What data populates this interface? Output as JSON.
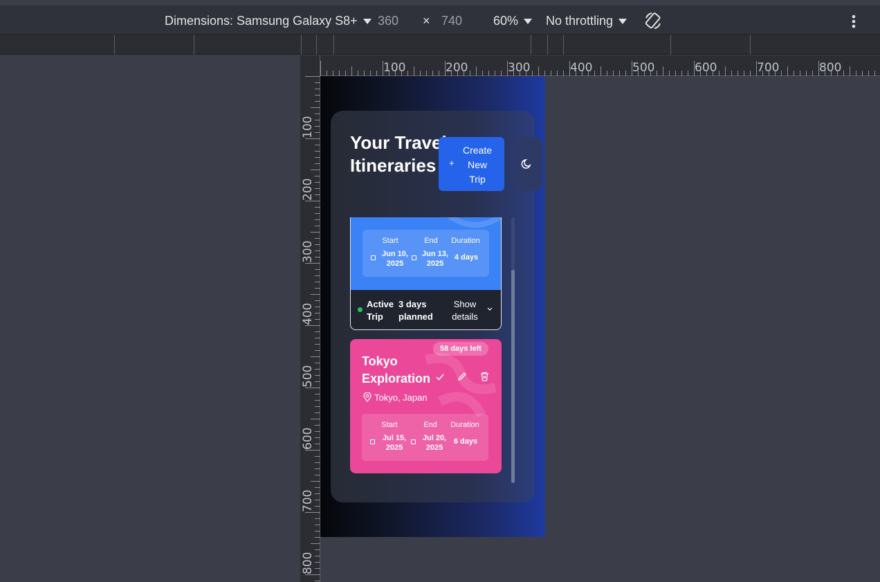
{
  "devtools": {
    "dimensions_label": "Dimensions: Samsung Galaxy S8+",
    "width": "360",
    "times": "×",
    "height": "740",
    "zoom": "60%",
    "throttling": "No throttling",
    "icons": [
      "rotate-icon",
      "more-vert-icon"
    ],
    "ruler_h": [
      "100",
      "200",
      "300",
      "400",
      "500",
      "600",
      "700",
      "800"
    ],
    "ruler_v": [
      "100",
      "200",
      "300",
      "400",
      "500",
      "600",
      "700",
      "800"
    ]
  },
  "app": {
    "title": "Your Travel Itineraries",
    "create_button": "Create New Trip",
    "create_plus": "+",
    "theme_icon": "moon-icon",
    "colors": {
      "primary": "#2563eb",
      "card_blue": "#3b82f6",
      "card_pink": "#ec4899",
      "active_dot": "#22c55e"
    },
    "trips": [
      {
        "start_label": "Start",
        "start_value": "Jun 10, 2025",
        "end_label": "End",
        "end_value": "Jun 13, 2025",
        "duration_label": "Duration",
        "duration_value": "4 days",
        "status": "Active Trip",
        "planned": "3 days planned",
        "toggle": "Show details"
      },
      {
        "days_left": "58 days left",
        "name": "Tokyo Exploration",
        "location": "Tokyo, Japan",
        "start_label": "Start",
        "start_value": "Jul 15, 2025",
        "end_label": "End",
        "end_value": "Jul 20, 2025",
        "duration_label": "Duration",
        "duration_value": "6 days",
        "icons": [
          "check-icon",
          "pencil-icon",
          "trash-icon",
          "map-pin-icon"
        ]
      }
    ]
  }
}
